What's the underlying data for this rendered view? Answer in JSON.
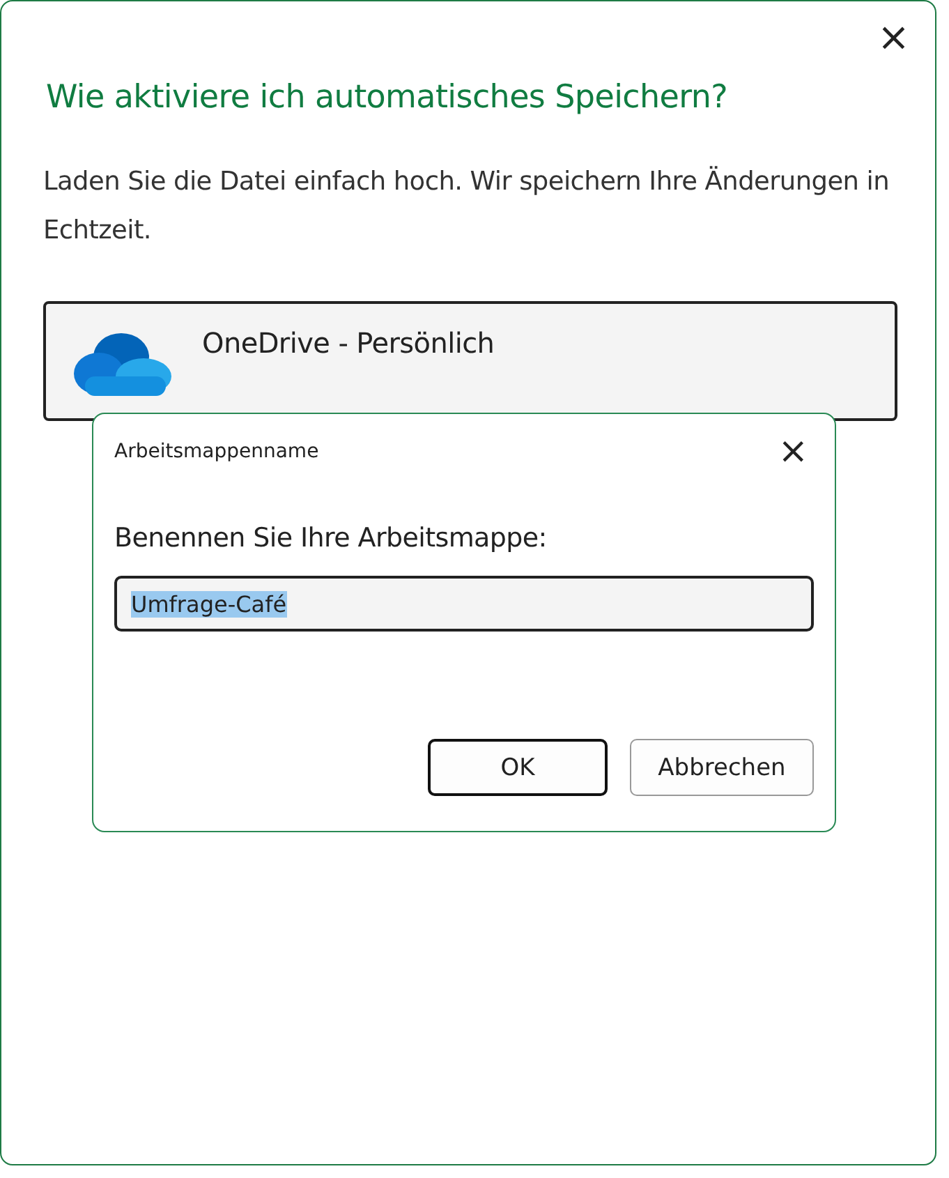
{
  "window": {
    "title": "Wie aktiviere ich automatisches Speichern?",
    "close": "×",
    "description": "Laden Sie die Datei einfach hoch. Wir speichern Ihre Änderungen in Echtzeit."
  },
  "locations": [
    {
      "label": "OneDrive - Persönlich"
    }
  ],
  "dialog": {
    "title": "Arbeitsmappenname",
    "close": "×",
    "prompt": "Benennen Sie Ihre Arbeitsmappe:",
    "field": {
      "value": "Umfrage-Café",
      "selected": true
    },
    "buttons": [
      {
        "label": "OK",
        "default": true
      },
      {
        "label": "Abbrechen",
        "default": false
      }
    ]
  }
}
